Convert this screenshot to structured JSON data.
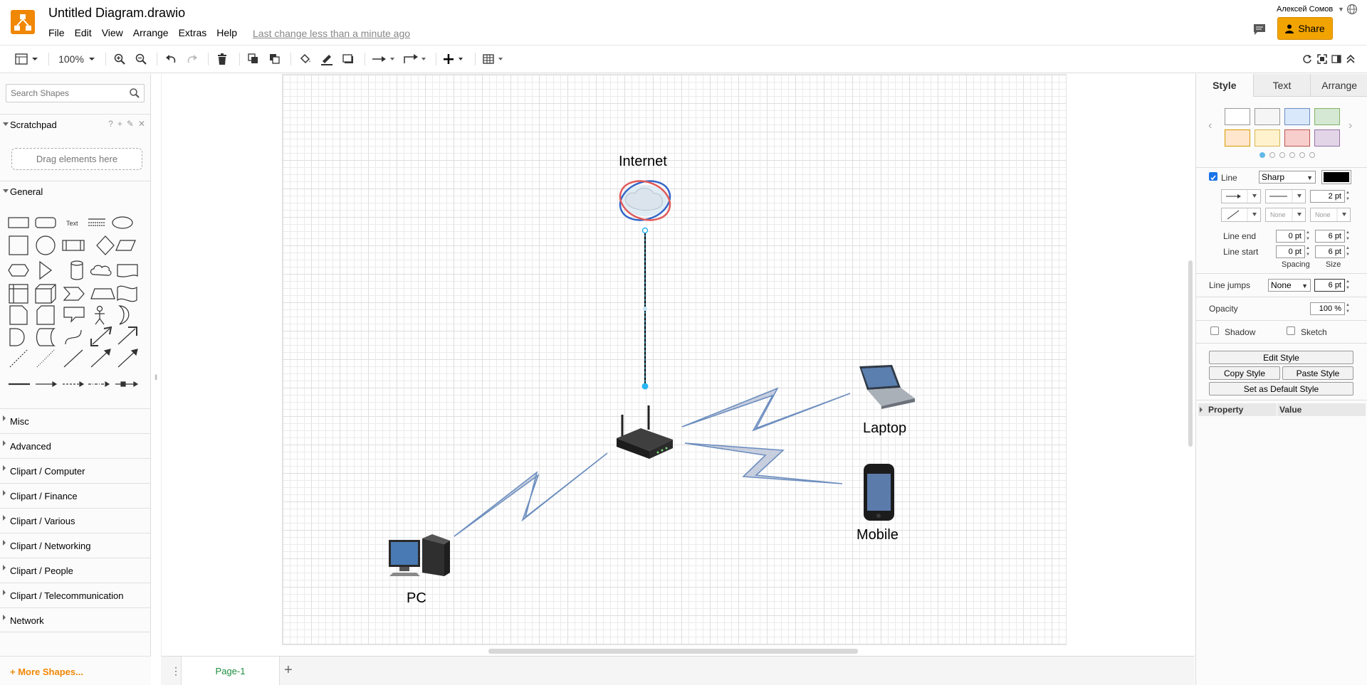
{
  "header": {
    "title": "Untitled Diagram.drawio",
    "menu": [
      "File",
      "Edit",
      "View",
      "Arrange",
      "Extras",
      "Help"
    ],
    "last_change": "Last change less than a minute ago",
    "user": "Алексей Сомов",
    "share_label": "Share",
    "brand_color": "#f08705",
    "share_color": "#f1a300"
  },
  "toolbar": {
    "zoom": "100%",
    "icons": [
      "format-panel-icon",
      "zoom-in-icon",
      "zoom-out-icon",
      "undo-icon",
      "redo-icon",
      "delete-icon",
      "to-front-icon",
      "to-back-icon",
      "fill-color-icon",
      "line-color-icon",
      "shadow-icon",
      "connection-icon",
      "waypoints-icon",
      "insert-icon",
      "table-icon",
      "refresh-icon",
      "fullscreen-icon",
      "toggle-panel-icon",
      "collapse-icon"
    ]
  },
  "left_panel": {
    "search_placeholder": "Search Shapes",
    "scratchpad": "Scratchpad",
    "drag_hint": "Drag elements here",
    "general": "General",
    "text_shape": "Text",
    "sections": [
      "Misc",
      "Advanced",
      "Clipart / Computer",
      "Clipart / Finance",
      "Clipart / Various",
      "Clipart / Networking",
      "Clipart / People",
      "Clipart / Telecommunication",
      "Network"
    ],
    "more_shapes": "+ More Shapes..."
  },
  "diagram": {
    "nodes": {
      "internet": "Internet",
      "laptop": "Laptop",
      "mobile": "Mobile",
      "pc": "PC"
    },
    "edge_color": "#6c8ebf",
    "edge_fill": "#c7cede"
  },
  "pages": {
    "tab": "Page-1",
    "add": "+"
  },
  "format_panel": {
    "tabs": [
      "Style",
      "Text",
      "Arrange"
    ],
    "swatch_colors": [
      "#ffffff",
      "#f5f5f5",
      "#dae8fc",
      "#d5e8d4",
      "#ffe6cc",
      "#fff2cc",
      "#f8cecc",
      "#e1d5e7"
    ],
    "line_label": "Line",
    "line_style": "Sharp",
    "line_width": "2 pt",
    "none_a": "None",
    "none_b": "None",
    "line_end": "Line end",
    "line_start": "Line start",
    "end_spacing": "0 pt",
    "end_size": "6 pt",
    "start_spacing": "0 pt",
    "start_size": "6 pt",
    "spacing": "Spacing",
    "size": "Size",
    "line_jumps": "Line jumps",
    "jumps_value": "None",
    "jumps_size": "6 pt",
    "opacity": "Opacity",
    "opacity_value": "100 %",
    "shadow": "Shadow",
    "sketch": "Sketch",
    "edit_style": "Edit Style",
    "copy_style": "Copy Style",
    "paste_style": "Paste Style",
    "set_default": "Set as Default Style",
    "property": "Property",
    "value": "Value"
  }
}
